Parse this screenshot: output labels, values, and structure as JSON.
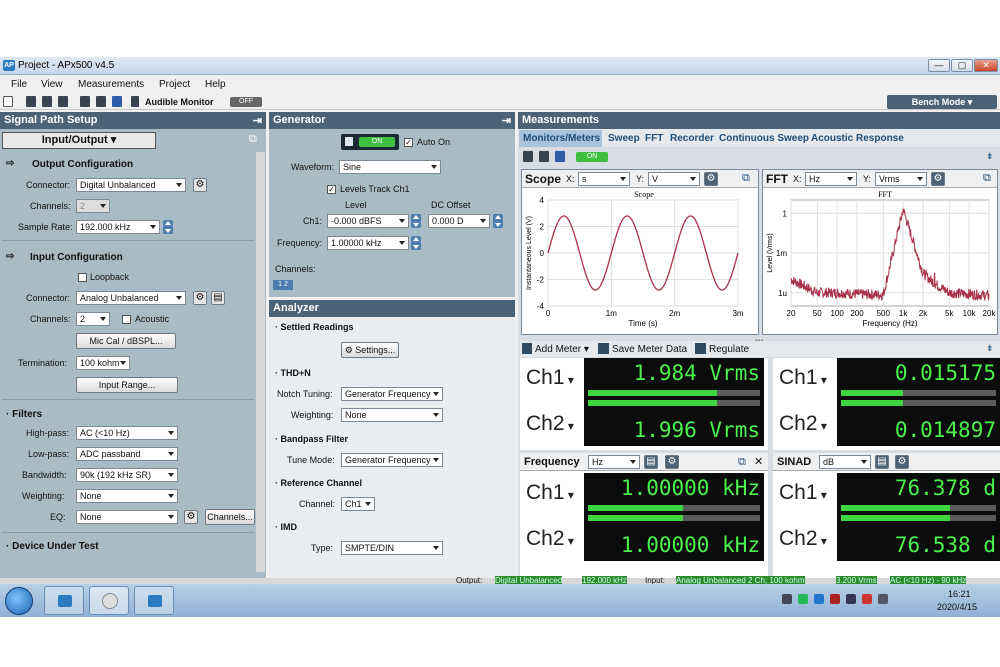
{
  "window": {
    "title": "Project - APx500 v4.5",
    "app_icon": "AP",
    "min": "—",
    "max": "▢",
    "close": "✕"
  },
  "menu": [
    "File",
    "View",
    "Measurements",
    "Project",
    "Help"
  ],
  "toolbar": {
    "audible_monitor": "Audible Monitor",
    "monitor_state": "OFF",
    "bench_mode": "Bench Mode"
  },
  "signal_path": {
    "title": "Signal Path Setup",
    "selector": "Input/Output",
    "output_config": {
      "title": "Output Configuration",
      "connector_label": "Connector:",
      "connector": "Digital Unbalanced",
      "channels_label": "Channels:",
      "channels": "2",
      "sample_rate_label": "Sample Rate:",
      "sample_rate": "192.000 kHz"
    },
    "input_config": {
      "title": "Input Configuration",
      "loopback": "Loopback",
      "connector_label": "Connector:",
      "connector": "Analog Unbalanced",
      "channels_label": "Channels:",
      "channels": "2",
      "acoustic": "Acoustic",
      "mic_cal": "Mic Cal / dBSPL...",
      "termination_label": "Termination:",
      "termination": "100 kohm",
      "input_range": "Input Range..."
    },
    "filters": {
      "title": "Filters",
      "highpass_label": "High-pass:",
      "highpass": "AC (<10 Hz)",
      "lowpass_label": "Low-pass:",
      "lowpass": "ADC passband",
      "bandwidth_label": "Bandwidth:",
      "bandwidth": "90k (192 kHz SR)",
      "weighting_label": "Weighting:",
      "weighting": "None",
      "eq_label": "EQ:",
      "eq": "None",
      "channels_btn": "Channels..."
    },
    "dut": {
      "title": "Device Under Test"
    }
  },
  "generator": {
    "title": "Generator",
    "on": "ON",
    "auto_on": "Auto On",
    "waveform_label": "Waveform:",
    "waveform": "Sine",
    "levels_track": "Levels Track Ch1",
    "level_hdr": "Level",
    "dc_hdr": "DC Offset",
    "ch1_label": "Ch1:",
    "level": "-0.000 dBFS",
    "dc": "0.000 D",
    "frequency_label": "Frequency:",
    "frequency": "1.00000 kHz",
    "channels_label": "Channels:",
    "ch_btns": "1 2"
  },
  "analyzer": {
    "title": "Analyzer",
    "settled": "Settled Readings",
    "settings": "Settings...",
    "thdn": "THD+N",
    "notch_label": "Notch Tuning:",
    "notch": "Generator Frequency",
    "weighting_label": "Weighting:",
    "weighting": "None",
    "bandpass": "Bandpass Filter",
    "tune_label": "Tune Mode:",
    "tune": "Generator Frequency",
    "refch": "Reference Channel",
    "channel_label": "Channel:",
    "channel": "Ch1",
    "imd": "IMD",
    "type_label": "Type:",
    "type": "SMPTE/DIN"
  },
  "measurements": {
    "title": "Measurements",
    "tabs": [
      "Monitors/Meters",
      "Sweep",
      "FFT",
      "Recorder",
      "Continuous Sweep",
      "Acoustic Response"
    ],
    "on": "ON",
    "scope": {
      "title": "Scope",
      "x_label": "X:",
      "x_unit": "s",
      "y_label": "Y:",
      "y_unit": "V",
      "plot_title": "Scope",
      "xlabel": "Time (s)",
      "ylabel": "Instantaneous Level (V)",
      "xticks": [
        "0",
        "1m",
        "2m",
        "3m"
      ],
      "yticks": [
        "4",
        "2",
        "0",
        "-2",
        "-4"
      ]
    },
    "fft": {
      "title": "FFT",
      "x_label": "X:",
      "x_unit": "Hz",
      "y_label": "Y:",
      "y_unit": "Vrms",
      "plot_title": "FFT",
      "xlabel": "Frequency (Hz)",
      "ylabel": "Level (Vrms)",
      "xticks": [
        "20",
        "50",
        "100",
        "200",
        "500",
        "1k",
        "2k",
        "5k",
        "10k",
        "20k"
      ],
      "yticks": [
        "1",
        "1m",
        "1u"
      ]
    },
    "add_meter": "Add Meter",
    "save_meter": "Save Meter Data",
    "regulate": "Regulate",
    "meters": [
      {
        "ch1": "1.984 Vrms",
        "ch2": "1.996 Vrms",
        "fill1": 0.75,
        "fill2": 0.75
      },
      {
        "ch1": "0.015175",
        "ch2": "0.014897",
        "fill1": 0.4,
        "fill2": 0.4
      },
      {
        "title": "Frequency",
        "unit": "Hz",
        "ch1": "1.00000 kHz",
        "ch2": "1.00000 kHz",
        "fill1": 0.55,
        "fill2": 0.55
      },
      {
        "title": "SINAD",
        "unit": "dB",
        "ch1": "76.378 d",
        "ch2": "76.538 d",
        "fill1": 0.7,
        "fill2": 0.7
      }
    ],
    "ch1": "Ch1",
    "ch2": "Ch2"
  },
  "status": {
    "output_label": "Output:",
    "output": "Digital Unbalanced",
    "sr": "192.000 kHz",
    "input_label": "Input:",
    "input": "Analog Unbalanced 2 Ch, 100 kohm",
    "range": "3.200 Vrms",
    "hp": "AC (<10 Hz) - 90 kHz"
  },
  "taskbar": {
    "time": "16:21",
    "date": "2020/4/15"
  },
  "chart_data": [
    {
      "type": "line",
      "title": "Scope",
      "xlabel": "Time (s)",
      "ylabel": "Instantaneous Level (V)",
      "xlim": [
        0,
        0.003
      ],
      "ylim": [
        -4,
        4
      ],
      "series": [
        {
          "x": [
            0,
            0.00025,
            0.0005,
            0.00075,
            0.001,
            0.00125,
            0.0015,
            0.00175,
            0.002,
            0.00225,
            0.0025,
            0.00275,
            0.003
          ],
          "values": [
            0,
            2.8,
            0,
            -2.8,
            0,
            2.8,
            0,
            -2.8,
            0,
            2.8,
            0,
            -2.8,
            0
          ]
        }
      ]
    },
    {
      "type": "line",
      "title": "FFT",
      "xlabel": "Frequency (Hz)",
      "ylabel": "Level (Vrms)",
      "scale": "log",
      "xlim": [
        20,
        20000
      ],
      "series": [
        {
          "x": [
            20,
            50,
            100,
            200,
            500,
            1000,
            2000,
            3000,
            5000,
            10000,
            20000
          ],
          "values": [
            1e-05,
            1e-06,
            1e-06,
            8e-07,
            7e-07,
            2,
            3e-05,
            5e-06,
            1e-06,
            8e-07,
            6e-07
          ]
        }
      ]
    }
  ]
}
